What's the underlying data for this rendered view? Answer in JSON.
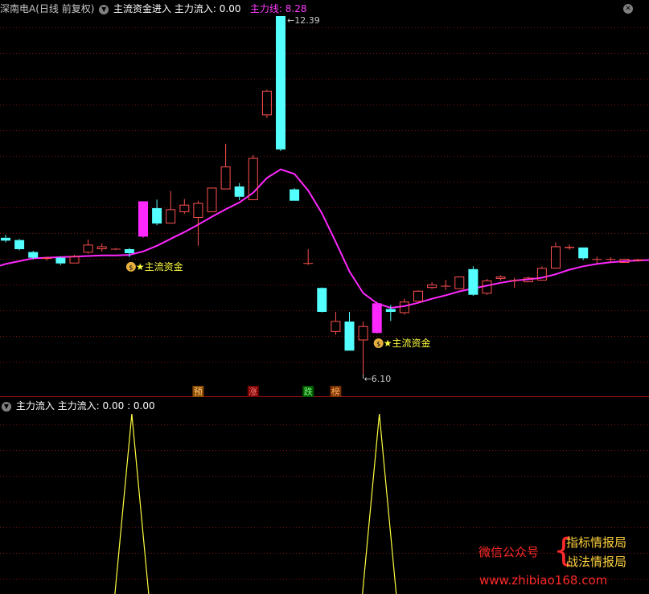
{
  "top_header": {
    "stock_name": "深南电A(日线 前复权)",
    "indicator_name": "主流资金进入",
    "inflow_label": "主力流入: 0.00",
    "line_label": "主力线: 8.28"
  },
  "bottom_header": {
    "indicator_name": "主力流入",
    "values_label": "主力流入: 0.00 : 0.00"
  },
  "colors": {
    "up": "#ff5050",
    "down": "#54ffff",
    "signal_bar": "#ff28ff",
    "ma_line": "#ff28ff",
    "grid": "#7a1010",
    "signal_text": "#ffff40",
    "spike_line": "#ffff40"
  },
  "chart_data": [
    {
      "type": "candlestick",
      "title": "",
      "price_range": [
        6.1,
        12.39
      ],
      "annotations": {
        "high_label": "12.39",
        "low_label": "6.10",
        "signal_label": "主流资金"
      },
      "candles": [
        {
          "o": 8.5,
          "h": 8.55,
          "l": 8.42,
          "c": 8.45
        },
        {
          "o": 8.46,
          "h": 8.48,
          "l": 8.28,
          "c": 8.3
        },
        {
          "o": 8.25,
          "h": 8.27,
          "l": 8.12,
          "c": 8.15
        },
        {
          "o": 8.13,
          "h": 8.17,
          "l": 8.1,
          "c": 8.15
        },
        {
          "o": 8.15,
          "h": 8.17,
          "l": 8.02,
          "c": 8.05
        },
        {
          "o": 8.05,
          "h": 8.2,
          "l": 8.05,
          "c": 8.18
        },
        {
          "o": 8.24,
          "h": 8.47,
          "l": 8.22,
          "c": 8.38
        },
        {
          "o": 8.3,
          "h": 8.4,
          "l": 8.26,
          "c": 8.35
        },
        {
          "o": 8.3,
          "h": 8.32,
          "l": 8.28,
          "c": 8.3
        },
        {
          "o": 8.3,
          "h": 8.32,
          "l": 8.16,
          "c": 8.23,
          "signal": true
        },
        {
          "o": 8.52,
          "h": 9.14,
          "l": 8.5,
          "c": 9.14,
          "bar": "signal"
        },
        {
          "o": 9.02,
          "h": 9.17,
          "l": 8.72,
          "c": 8.75
        },
        {
          "o": 8.75,
          "h": 9.32,
          "l": 8.75,
          "c": 9.0
        },
        {
          "o": 8.95,
          "h": 9.18,
          "l": 8.92,
          "c": 9.08
        },
        {
          "o": 8.85,
          "h": 9.15,
          "l": 8.36,
          "c": 9.11
        },
        {
          "o": 8.95,
          "h": 9.38,
          "l": 8.95,
          "c": 9.38
        },
        {
          "o": 9.35,
          "h": 10.15,
          "l": 9.35,
          "c": 9.75
        },
        {
          "o": 9.4,
          "h": 9.46,
          "l": 9.16,
          "c": 9.22
        },
        {
          "o": 9.16,
          "h": 9.95,
          "l": 9.16,
          "c": 9.9
        },
        {
          "o": 10.65,
          "h": 11.1,
          "l": 10.6,
          "c": 11.08
        },
        {
          "o": 12.39,
          "h": 12.39,
          "l": 10.02,
          "c": 10.05
        },
        {
          "o": 9.35,
          "h": 9.37,
          "l": 9.15,
          "c": 9.15
        },
        {
          "o": 8.05,
          "h": 8.3,
          "l": 8.02,
          "c": 8.05
        },
        {
          "o": 7.62,
          "h": 7.63,
          "l": 7.19,
          "c": 7.2
        },
        {
          "o": 6.85,
          "h": 7.2,
          "l": 6.8,
          "c": 7.04
        },
        {
          "o": 7.03,
          "h": 7.2,
          "l": 6.52,
          "c": 6.52
        },
        {
          "o": 6.7,
          "h": 7.03,
          "l": 6.1,
          "c": 6.95
        },
        {
          "o": 6.83,
          "h": 7.38,
          "l": 6.82,
          "c": 7.35,
          "bar": "signal",
          "signal": true
        },
        {
          "o": 7.25,
          "h": 7.32,
          "l": 7.04,
          "c": 7.2
        },
        {
          "o": 7.18,
          "h": 7.43,
          "l": 7.15,
          "c": 7.38
        },
        {
          "o": 7.38,
          "h": 7.58,
          "l": 7.38,
          "c": 7.57
        },
        {
          "o": 7.62,
          "h": 7.72,
          "l": 7.6,
          "c": 7.68
        },
        {
          "o": 7.65,
          "h": 7.76,
          "l": 7.58,
          "c": 7.65
        },
        {
          "o": 7.6,
          "h": 7.82,
          "l": 7.6,
          "c": 7.82
        },
        {
          "o": 7.95,
          "h": 8.0,
          "l": 7.48,
          "c": 7.5
        },
        {
          "o": 7.52,
          "h": 7.78,
          "l": 7.5,
          "c": 7.75
        },
        {
          "o": 7.78,
          "h": 7.84,
          "l": 7.75,
          "c": 7.82
        },
        {
          "o": 7.75,
          "h": 7.8,
          "l": 7.62,
          "c": 7.75
        },
        {
          "o": 7.72,
          "h": 7.82,
          "l": 7.72,
          "c": 7.8
        },
        {
          "o": 7.75,
          "h": 8.0,
          "l": 7.75,
          "c": 7.97
        },
        {
          "o": 7.96,
          "h": 8.42,
          "l": 7.96,
          "c": 8.35
        },
        {
          "o": 8.32,
          "h": 8.38,
          "l": 8.29,
          "c": 8.34
        },
        {
          "o": 8.33,
          "h": 8.33,
          "l": 8.11,
          "c": 8.14
        },
        {
          "o": 8.12,
          "h": 8.17,
          "l": 8.05,
          "c": 8.12
        },
        {
          "o": 8.12,
          "h": 8.16,
          "l": 8.08,
          "c": 8.12
        },
        {
          "o": 8.06,
          "h": 8.13,
          "l": 8.06,
          "c": 8.13
        },
        {
          "o": 8.1,
          "h": 8.13,
          "l": 8.08,
          "c": 8.12
        }
      ],
      "ma_line": [
        8.04,
        8.09,
        8.14,
        8.15,
        8.16,
        8.17,
        8.18,
        8.19,
        8.19,
        8.2,
        8.26,
        8.36,
        8.48,
        8.6,
        8.73,
        8.87,
        9.0,
        9.12,
        9.29,
        9.55,
        9.7,
        9.62,
        9.33,
        8.93,
        8.43,
        7.91,
        7.53,
        7.35,
        7.27,
        7.3,
        7.36,
        7.43,
        7.49,
        7.56,
        7.61,
        7.66,
        7.71,
        7.75,
        7.77,
        7.8,
        7.86,
        7.94,
        8.0,
        8.04,
        8.07,
        8.09
      ]
    },
    {
      "type": "line",
      "title": "",
      "x": [
        9,
        27
      ],
      "values": [
        1,
        1
      ],
      "ylim": [
        0,
        1
      ],
      "ticker_markers": [
        {
          "index": 14,
          "text": "预",
          "bg": "#8a4a00",
          "fg": "#ffcc80"
        },
        {
          "index": 18,
          "text": "涨",
          "bg": "#7a0000",
          "fg": "#ff8080"
        },
        {
          "index": 22,
          "text": "跌",
          "bg": "#005a00",
          "fg": "#80ff80"
        },
        {
          "index": 24,
          "text": "榜",
          "bg": "#7a3000",
          "fg": "#ffb060"
        }
      ]
    }
  ],
  "watermark": {
    "wechat": "微信公众号",
    "line1": "指标情报局",
    "line2": "战法情报局",
    "url": "www.zhibiao168.com"
  }
}
